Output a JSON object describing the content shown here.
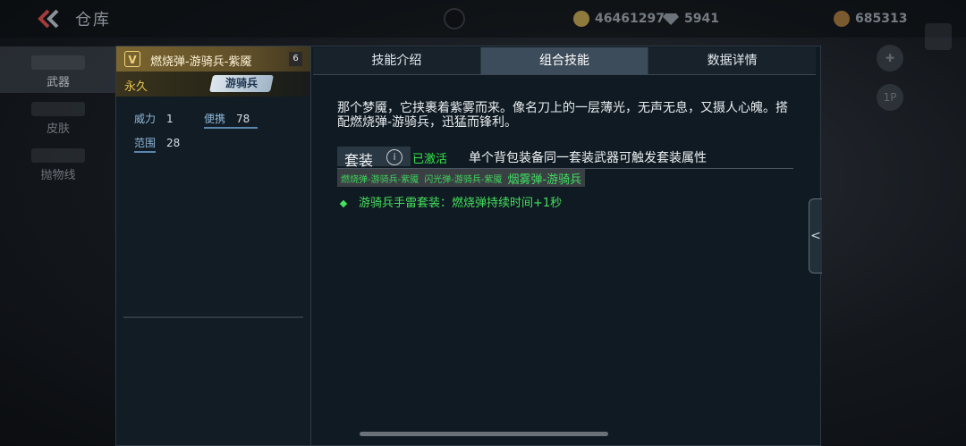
{
  "topbar": {
    "title": "仓库",
    "currencies": [
      {
        "icon": "gold-coin-icon",
        "amount": "46461297"
      },
      {
        "icon": "diamond-icon",
        "amount": "5941"
      },
      {
        "icon": "coin-icon",
        "amount": "685313"
      }
    ]
  },
  "nav": {
    "items": [
      {
        "label": "武器",
        "active": true
      },
      {
        "label": "皮肤",
        "active": false
      },
      {
        "label": "抛物线",
        "active": false
      }
    ]
  },
  "item": {
    "name": "燃烧弹-游骑兵-紫魇",
    "level": "6",
    "duration": "永久",
    "suit_tag": "游骑兵",
    "stats": [
      {
        "label": "威力",
        "value": "1"
      },
      {
        "label": "便携",
        "value": "78"
      },
      {
        "label": "范围",
        "value": "28"
      }
    ]
  },
  "tabs": [
    {
      "label": "技能介绍",
      "active": false
    },
    {
      "label": "组合技能",
      "active": true
    },
    {
      "label": "数据详情",
      "active": false
    }
  ],
  "content": {
    "description": "那个梦魇，它挟裹着紫雾而来。像名刀上的一层薄光，无声无息，又摄人心魄。搭配燃烧弹-游骑兵，迅猛而锋利。",
    "set_label": "套装",
    "info_glyph": "i",
    "activated": "已激活",
    "set_desc": "单个背包装备同一套装武器可触发套装属性",
    "members": [
      "燃烧弹-游骑兵-紫魇",
      "闪光弹-游骑兵-紫魇",
      "烟雾弹-游骑兵"
    ],
    "bonus": "游骑兵手雷套装：燃烧弹持续时间+1秒"
  },
  "side": {
    "collapse_glyph": "<",
    "btn_label": "1P"
  },
  "colors": {
    "gold": "#e7c24c",
    "green": "#34e14a",
    "active_tab": "#3c4c5a"
  }
}
